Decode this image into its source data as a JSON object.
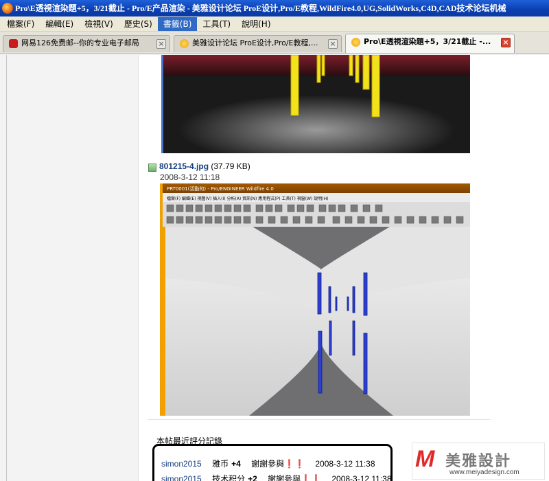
{
  "window": {
    "title": "Pro\\E透視渲染題+5，3/21截止 - Pro/E产品渲染 - 美雅设计论坛 ProE设计,Pro/E教程,WildFire4.0,UG,SolidWorks,C4D,CAD技术论坛机械"
  },
  "menu": {
    "items": [
      {
        "label": "檔案(F)"
      },
      {
        "label": "編輯(E)"
      },
      {
        "label": "檢視(V)"
      },
      {
        "label": "歷史(S)"
      },
      {
        "label": "書籤(B)"
      },
      {
        "label": "工具(T)"
      },
      {
        "label": "說明(H)"
      }
    ]
  },
  "tabs": [
    {
      "label": "网易126免费邮--你的专业电子邮局",
      "icon": "mail-icon"
    },
    {
      "label": "美雅设计论坛 ProE设计,Pro/E教程,...",
      "icon": "bulb-icon"
    },
    {
      "label": "Pro\\E透視渲染題+5，3/21截止 -...",
      "icon": "bulb-icon"
    }
  ],
  "attachment": {
    "filename": "801215-4.jpg",
    "size": "(37.79 KB)",
    "date": "2008-3-12 11:18"
  },
  "screenshot_app": {
    "title": "PRT0001(活動的) - Pro/ENGINEER Wildfire 4.0",
    "menu": "檔案(F)  編輯(E)  視圖(V)  插入(I)  分析(A)  資訊(N)  應用程式(P)  工具(T)  視窗(W)  說明(H)"
  },
  "ratelog": {
    "title": "本帖最近評分記錄",
    "rows": [
      {
        "user": "simon2015",
        "score_name": "雅币",
        "score_value": "+4",
        "reason": "謝謝參與❗❗",
        "time": "2008-3-12 11:38"
      },
      {
        "user": "simon2015",
        "score_name": "技术积分",
        "score_value": "+2",
        "reason": "謝謝參與❗❗",
        "time": "2008-3-12 11:38"
      }
    ]
  },
  "brand": {
    "logo_letter": "M",
    "name": "美雅設計",
    "url": "www.meiyadesign.com"
  },
  "colors": {
    "accent": "#316ac5",
    "titlebar": "#0a3fb0",
    "link": "#153e7e"
  }
}
